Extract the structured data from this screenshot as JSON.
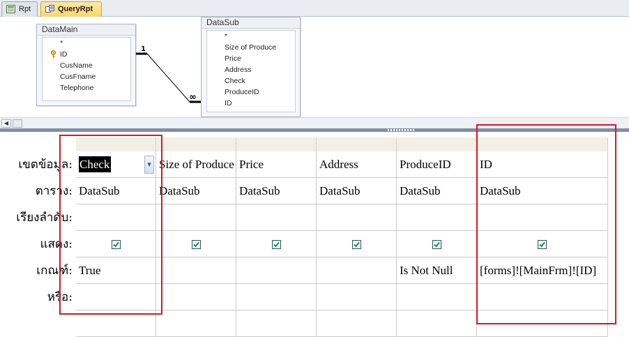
{
  "tabs": [
    {
      "label": "Rpt",
      "icon": "report-icon",
      "active": false
    },
    {
      "label": "QueryRpt",
      "icon": "query-icon",
      "active": true
    }
  ],
  "tables": [
    {
      "name": "DataMain",
      "fields": [
        "*",
        "ID",
        "CusName",
        "CusFname",
        "Telephone"
      ],
      "key_field": "ID"
    },
    {
      "name": "DataSub",
      "fields": [
        "*",
        "Size of Produce",
        "Price",
        "Address",
        "Check",
        "ProduceID",
        "ID"
      ]
    }
  ],
  "relationship": {
    "one_label": "1",
    "many_label": "∞"
  },
  "grid": {
    "row_labels": [
      "เขตข้อมูล:",
      "ตาราง:",
      "เรียงลำดับ:",
      "แสดง:",
      "เกณฑ์:",
      "หรือ:"
    ],
    "columns": [
      {
        "field": "Check",
        "table": "DataSub",
        "sort": "",
        "show": true,
        "criteria": "True",
        "or": ""
      },
      {
        "field": "Size of Produce",
        "table": "DataSub",
        "sort": "",
        "show": true,
        "criteria": "",
        "or": ""
      },
      {
        "field": "Price",
        "table": "DataSub",
        "sort": "",
        "show": true,
        "criteria": "",
        "or": ""
      },
      {
        "field": "Address",
        "table": "DataSub",
        "sort": "",
        "show": true,
        "criteria": "",
        "or": ""
      },
      {
        "field": "ProduceID",
        "table": "DataSub",
        "sort": "",
        "show": true,
        "criteria": "Is Not Null",
        "or": ""
      },
      {
        "field": "ID",
        "table": "DataSub",
        "sort": "",
        "show": true,
        "criteria": "[forms]![MainFrm]![ID]",
        "or": ""
      }
    ]
  },
  "colors": {
    "highlight_box": "#e0141c",
    "selection": "#000000",
    "splitter": "#7f8fa8"
  }
}
